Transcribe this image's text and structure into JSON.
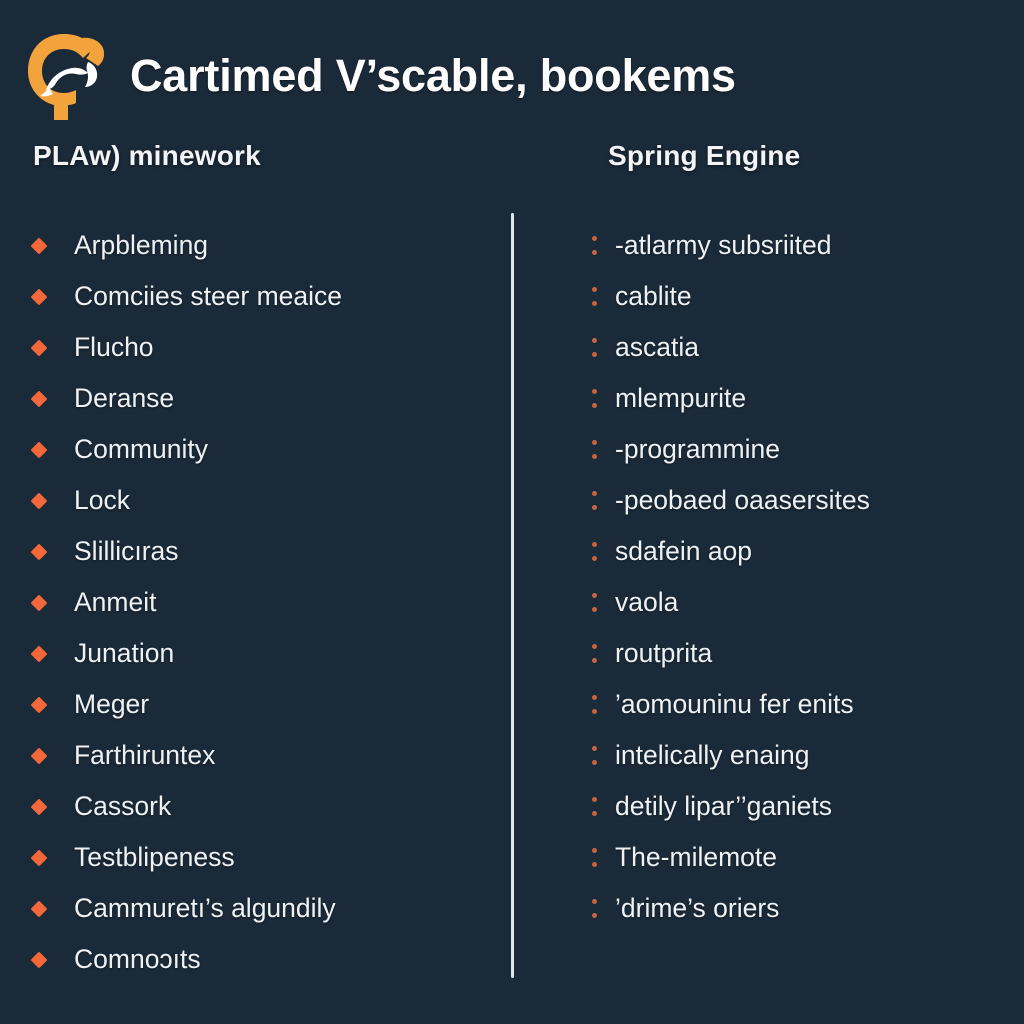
{
  "header": {
    "logo_icon": "circular-c-hands-logo",
    "title": "Cartimed V’scable, bookems"
  },
  "theme": {
    "background": "#1b2a38",
    "accent": "#f2683a",
    "text": "#eef2f5",
    "divider": "#dfe6ec"
  },
  "columns": {
    "left": {
      "heading": "PLAw) minework",
      "bullet": "orange-diamond",
      "items": [
        {
          "label": "Arpbleming"
        },
        {
          "label": "Comciies steer meaice"
        },
        {
          "label": "Flucho"
        },
        {
          "label": "Deranse"
        },
        {
          "label": "Community"
        },
        {
          "label": "Lock"
        },
        {
          "label": "Slillicıras"
        },
        {
          "label": "Anmeit"
        },
        {
          "label": "Junation"
        },
        {
          "label": "Meger"
        },
        {
          "label": "Farthiruntex"
        },
        {
          "label": "Cassork"
        },
        {
          "label": "Testblipeness"
        },
        {
          "label": "Cammuretı’s algundily"
        },
        {
          "label": "Comnoɔıts"
        }
      ]
    },
    "right": {
      "heading": "Spring Engine",
      "bullet": "orange-colon-dots",
      "items": [
        {
          "label": "-atlarmy subsriited"
        },
        {
          "label": "cablite"
        },
        {
          "label": "ascatia"
        },
        {
          "label": "mlempurite"
        },
        {
          "label": "-programmine"
        },
        {
          "label": "-peobaed oaasersites"
        },
        {
          "label": "sdafein aop"
        },
        {
          "label": "vaola"
        },
        {
          "label": "routprita"
        },
        {
          "label": "’aomouninu fer enits"
        },
        {
          "label": "intelically enaing"
        },
        {
          "label": "detily lipar’’ganiets"
        },
        {
          "label": "The-milemote"
        },
        {
          "label": "’drime’s oriers"
        }
      ]
    }
  }
}
